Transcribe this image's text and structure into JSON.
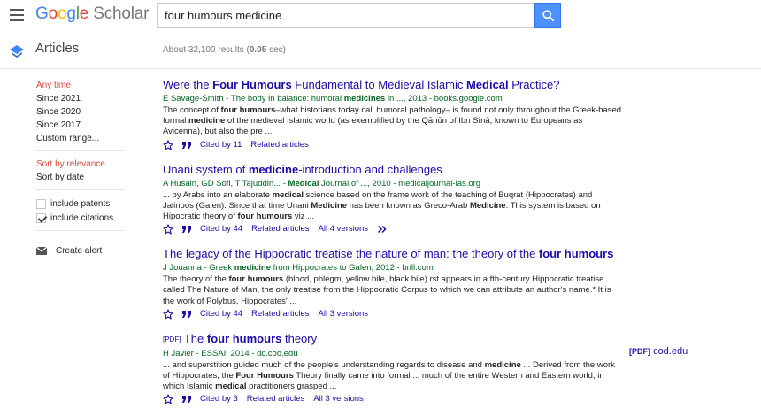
{
  "header": {
    "logo_google": "Google",
    "logo_scholar": "Scholar",
    "search_value": "four humours medicine",
    "menu_icon": "hamburger-icon",
    "search_icon": "search-icon"
  },
  "subbar": {
    "section_label": "Articles",
    "results_prefix": "About 32,100 results (",
    "results_time": "0.05",
    "results_suffix": " sec)"
  },
  "sidebar": {
    "time_filters": [
      "Any time",
      "Since 2021",
      "Since 2020",
      "Since 2017",
      "Custom range..."
    ],
    "sort_options": [
      "Sort by relevance",
      "Sort by date"
    ],
    "include_patents": "include patents",
    "include_citations": "include citations",
    "create_alert": "Create alert"
  },
  "results": [
    {
      "pdf_tag": "",
      "title_html": "Were the <b>Four Humours</b> Fundamental to Medieval Islamic <b>Medical</b> Practice?",
      "meta_html": "E Savage-Smith - The body in balance: humoral <b>medicines</b> in ..., 2013 - books.google.com",
      "snippet_html": "The concept of <b>four humours</b>–what historians today call humoral pathology– is found not only throughout the Greek-based formal <b>medicine</b> of the medieval Islamic world (as exemplified by the Qānūn of Ibn Sīnā, known to Europeans as Avicenna), but also the pre ...",
      "cited_by": "Cited by 11",
      "related": "Related articles",
      "versions": ""
    },
    {
      "pdf_tag": "",
      "title_html": "Unani system of <b>medicine</b>-introduction and challenges",
      "meta_html": "A Husain, GD Sofi, T Tajuddin... - <b>Medical</b> Journal of ..., 2010 - medicaljournal-ias.org",
      "snippet_html": "... by Arabs into an elaborate <b>medical</b> science based on the frame work of the teaching of Buqrat (Hippocrates) and Jalinoos (Galen). Since that time Unani <b>Medicine</b> has been known as Greco-Arab <b>Medicine</b>. This system is based on Hipocratic theory of <b>four humours</b> viz ...",
      "cited_by": "Cited by 44",
      "related": "Related articles",
      "versions": "All 4 versions"
    },
    {
      "pdf_tag": "",
      "title_html": "The legacy of the Hippocratic treatise the nature of man: the theory of the <b>four humours</b>",
      "meta_html": "J Jouanna - Greek <b>medicine</b> from Hippocrates to Galen, 2012 - brill.com",
      "snippet_html": "The theory of the <b>four humours</b> (blood, phlegm, yellow bile, black bile) rst appears in a fth-century Hippocratic treatise called The Nature of Man, the only treatise from the Hippocratic Corpus to which we can attribute an author's name.* It is the work of Polybus, Hippocrates' ...",
      "cited_by": "Cited by 44",
      "related": "Related articles",
      "versions": "All 3 versions"
    },
    {
      "pdf_tag": "[PDF]",
      "title_html": "The <b>four humours</b> theory",
      "meta_html": "H Javier - ESSAI, 2014 - dc.cod.edu",
      "snippet_html": "... and superstition guided much of the people's understanding regards to disease and <b>medicine</b> ... Derived from the work of Hippocrates, the <b>Four Humours</b> Theory finally came into formal ... much of the entire Western and Eastern world, in which Islamic <b>medical</b> practitioners grasped ...",
      "cited_by": "Cited by 3",
      "related": "Related articles",
      "versions": "All 3 versions"
    }
  ],
  "side_pdf": {
    "tag": "[PDF]",
    "domain": "cod.edu"
  },
  "colors": {
    "link": "#1a0dab",
    "meta_green": "#006621",
    "accent_red": "#dd4b39",
    "search_button": "#4d90fe"
  }
}
